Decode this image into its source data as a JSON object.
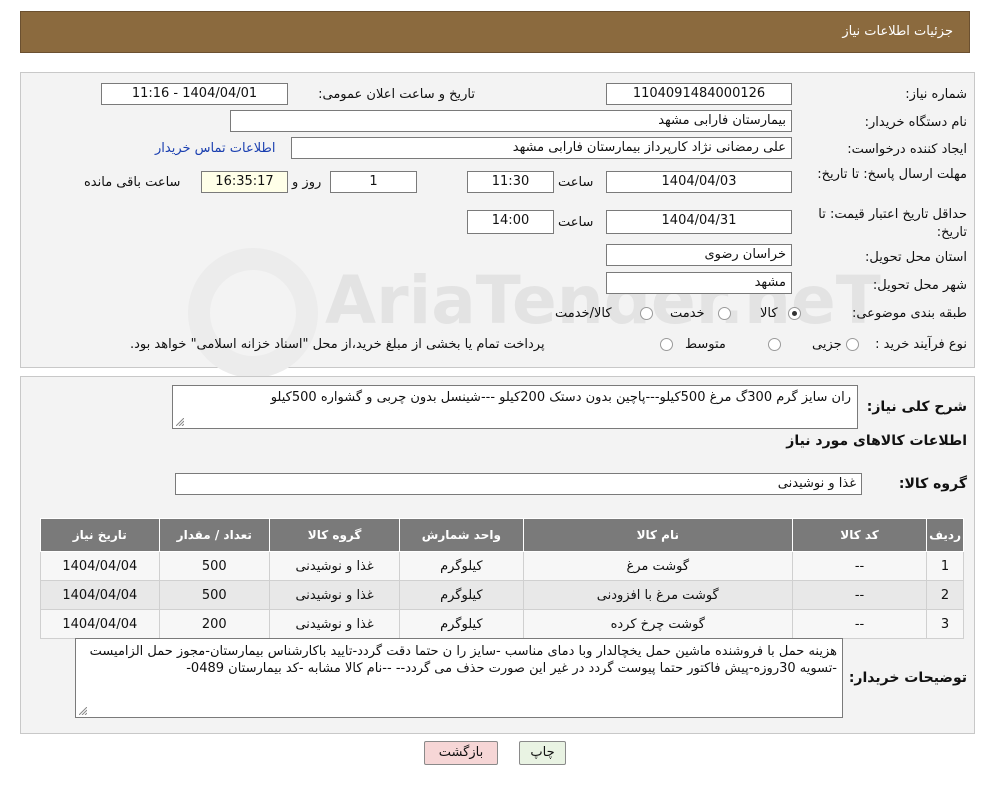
{
  "header": {
    "title": "جزئیات اطلاعات نیاز"
  },
  "watermark": {
    "text": "AriaTender.neT"
  },
  "fields": {
    "need_number_label": "شماره نیاز:",
    "need_number": "1104091484000126",
    "announce_label": "تاریخ و ساعت اعلان عمومی:",
    "announce_value": "1404/04/01 - 11:16",
    "buyer_org_label": "نام دستگاه خریدار:",
    "buyer_org": "بیمارستان فارابی مشهد",
    "creator_label": "ایجاد کننده درخواست:",
    "creator": "علی رمضانی نژاد کارپرداز بیمارستان فارابی مشهد",
    "contact_link": "اطلاعات تماس خریدار",
    "deadline_label": "مهلت ارسال پاسخ: تا تاریخ:",
    "deadline_date": "1404/04/03",
    "time_label": "ساعت",
    "deadline_time": "11:30",
    "days_value": "1",
    "days_label": "روز و",
    "remaining_time": "16:35:17",
    "remaining_label": "ساعت باقی مانده",
    "validity_label": "حداقل تاریخ اعتبار قیمت: تا تاریخ:",
    "validity_date": "1404/04/31",
    "validity_time": "14:00",
    "province_label": "استان محل تحویل:",
    "province": "خراسان رضوی",
    "city_label": "شهر محل تحویل:",
    "city": "مشهد",
    "category_label": "طبقه بندی موضوعی:",
    "category_options": [
      "کالا",
      "خدمت",
      "کالا/خدمت"
    ],
    "category_selected": "کالا",
    "process_label": "نوع فرآیند خرید :",
    "process_options": [
      "جزیی",
      "متوسط"
    ],
    "process_note": "پرداخت تمام یا بخشی از مبلغ خرید،از محل \"اسناد خزانه اسلامی\" خواهد بود."
  },
  "summary": {
    "label": "شرح کلی نیاز:",
    "text": "ران سایز گرم 300گ مرغ 500کیلو---پاچین بدون دستک 200کیلو ---شینسل بدون چربی و گشواره 500کیلو"
  },
  "goods": {
    "section_title": "اطلاعات کالاهای مورد نیاز",
    "group_label": "گروه کالا:",
    "group_value": "غذا و نوشیدنی",
    "columns": [
      "ردیف",
      "کد کالا",
      "نام کالا",
      "واحد شمارش",
      "گروه کالا",
      "تعداد / مقدار",
      "تاریخ نیاز"
    ],
    "rows": [
      [
        "1",
        "--",
        "گوشت مرغ",
        "کیلوگرم",
        "غذا و نوشیدنی",
        "500",
        "1404/04/04"
      ],
      [
        "2",
        "--",
        "گوشت مرغ با افزودنی",
        "کیلوگرم",
        "غذا و نوشیدنی",
        "500",
        "1404/04/04"
      ],
      [
        "3",
        "--",
        "گوشت چرخ کرده",
        "کیلوگرم",
        "غذا و نوشیدنی",
        "200",
        "1404/04/04"
      ]
    ]
  },
  "buyer_notes": {
    "label": "توضیحات خریدار:",
    "text": "هزینه حمل با فروشنده ماشین حمل یخچالدار وبا دمای مناسب -سایز را ن حتما دقت گردد-تایید باکارشناس بیمارستان-مجوز حمل الزامیست -تسویه 30روزه-پیش فاکتور حتما پیوست گردد در غیر این صورت حذف می گردد-- --نام کالا مشابه -کد بیمارستان 0489-"
  },
  "actions": {
    "print": "چاپ",
    "back": "بازگشت"
  },
  "colors": {
    "header_bg": "#8b6a3e",
    "table_header": "#7a7a7a",
    "back_button": "#f6d6d6",
    "print_button": "#e9f3e3"
  }
}
